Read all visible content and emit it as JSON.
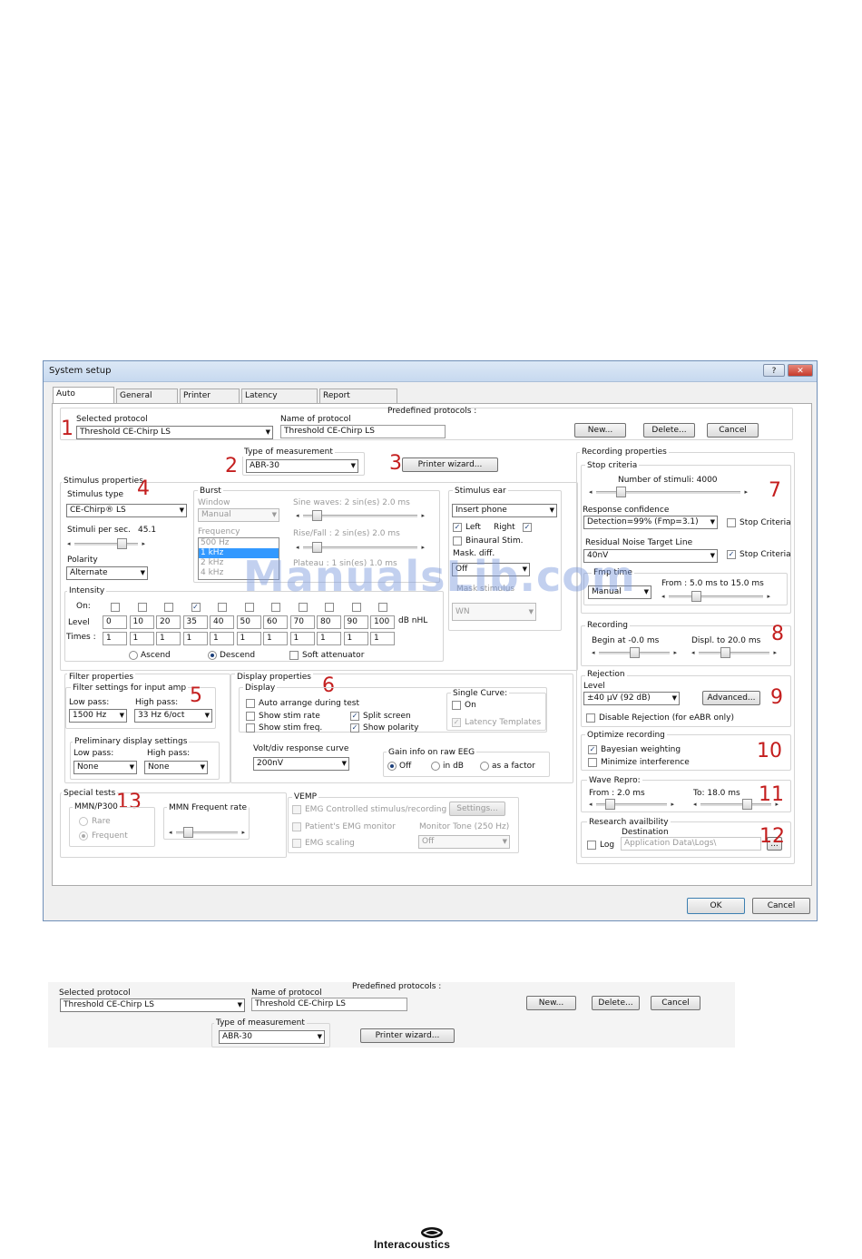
{
  "window": {
    "title": "System setup",
    "help": "?",
    "close": "✕"
  },
  "tabs": [
    "Auto protocols",
    "General Setup",
    "Printer Setup",
    "Latency Template",
    "Report Templates"
  ],
  "markers": [
    "1",
    "2",
    "3",
    "4",
    "5",
    "6",
    "7",
    "8",
    "9",
    "10",
    "11",
    "12",
    "13"
  ],
  "protocol": {
    "selected_label": "Selected protocol",
    "selected_value": "Threshold CE-Chirp LS",
    "name_label": "Name of protocol",
    "name_value": "Threshold CE-Chirp LS",
    "predefined_label": "Predefined protocols :",
    "new": "New...",
    "delete": "Delete...",
    "cancel": "Cancel"
  },
  "measurement": {
    "label": "Type of measurement",
    "value": "ABR-30",
    "printer_wizard": "Printer wizard..."
  },
  "stimulus": {
    "group": "Stimulus properties",
    "type_label": "Stimulus type",
    "type_value": "CE-Chirp® LS",
    "rate_label": "Stimuli per sec.",
    "rate_value": "45.1",
    "polarity_label": "Polarity",
    "polarity_value": "Alternate",
    "burst": "Burst",
    "window_label": "Window",
    "window_value": "Manual",
    "sine_label": "Sine waves: 2 sin(es) 2.0 ms",
    "freq_label": "Frequency",
    "freqs": [
      "500 Hz",
      "1 kHz",
      "2 kHz",
      "4 kHz"
    ],
    "rise_label": "Rise/Fall : 2 sin(es) 2.0 ms",
    "plateau_label": "Plateau : 1 sin(es) 1.0 ms",
    "ear_group": "Stimulus ear",
    "ear_value": "Insert phone",
    "left": "Left",
    "right": "Right",
    "binaural": "Binaural Stim.",
    "mask_label": "Mask. diff.",
    "mask_value": "Off",
    "mask_stim_label": "Mask stimulus",
    "mask_stim_value": "WN"
  },
  "intensity": {
    "group": "Intensity",
    "on_label": "On:",
    "level_label": "Level",
    "times_label": "Times :",
    "levels": [
      "0",
      "10",
      "20",
      "35",
      "40",
      "50",
      "60",
      "70",
      "80",
      "90",
      "100"
    ],
    "checked": [
      false,
      false,
      false,
      true,
      false,
      false,
      false,
      false,
      false,
      false,
      false
    ],
    "times": [
      "1",
      "1",
      "1",
      "1",
      "1",
      "1",
      "1",
      "1",
      "1",
      "1",
      "1"
    ],
    "unit": "dB nHL",
    "ascend": "Ascend",
    "descend": "Descend",
    "soft": "Soft attenuator"
  },
  "filter": {
    "group": "Filter properties",
    "input_label": "Filter settings for input amp",
    "low_label": "Low pass:",
    "low_value": "1500 Hz",
    "high_label": "High pass:",
    "high_value": "33 Hz 6/oct",
    "prelim_label": "Preliminary display settings",
    "plow_label": "Low pass:",
    "plow_value": "None",
    "phigh_label": "High pass:",
    "phigh_value": "None"
  },
  "display": {
    "group": "Display properties",
    "sub": "Display",
    "auto": "Auto arrange during test",
    "stim_rate": "Show stim rate",
    "stim_freq": "Show stim freq.",
    "split": "Split screen",
    "polarity": "Show polarity",
    "single_label": "Single Curve:",
    "single_on": "On",
    "latency": "Latency Templates",
    "volt_label": "Volt/div response curve",
    "volt_value": "200nV",
    "gain_label": "Gain info on raw EEG",
    "gain_off": "Off",
    "gain_db": "in dB",
    "gain_factor": "as a factor"
  },
  "special": {
    "group": "Special tests",
    "mmn": "MMN/P300",
    "rare": "Rare",
    "frequent": "Frequent",
    "mmn_rate": "MMN Frequent rate"
  },
  "vemp": {
    "group": "VEMP",
    "emg": "EMG Controlled stimulus/recording",
    "settings": "Settings...",
    "monitor": "Patient's EMG monitor",
    "tone_label": "Monitor Tone (250 Hz)",
    "tone_value": "Off",
    "scaling": "EMG scaling"
  },
  "recording_props": {
    "group": "Recording properties",
    "stop": "Stop criteria",
    "stimuli": "Number of stimuli: 4000",
    "conf_label": "Response confidence",
    "conf_value": "Detection=99% (Fmp=3.1)",
    "stop_crit": "Stop Criteria",
    "rn_label": "Residual Noise Target Line",
    "rn_value": "40nV",
    "fmp_label": "Fmp time",
    "fmp_value": "Manual",
    "fmp_range": "From : 5.0 ms to 15.0 ms"
  },
  "recording": {
    "group": "Recording",
    "begin": "Begin at  -0.0 ms",
    "displ": "Displ. to  20.0 ms"
  },
  "rejection": {
    "group": "Rejection",
    "level_label": "Level",
    "level_value": "±40 µV (92 dB)",
    "advanced": "Advanced...",
    "disable": "Disable Rejection (for eABR only)"
  },
  "optimize": {
    "group": "Optimize recording",
    "bayes": "Bayesian weighting",
    "minimize": "Minimize interference"
  },
  "wave": {
    "group": "Wave Repro:",
    "from": "From : 2.0 ms",
    "to": "To:  18.0 ms"
  },
  "research": {
    "group": "Research availbility",
    "dest": "Destination",
    "log": "Log",
    "path": "Application Data\\Logs\\",
    "browse": "..."
  },
  "footer": {
    "ok": "OK",
    "cancel": "Cancel"
  },
  "watermark": "ManualsLib.com",
  "crop": {
    "selected_label": "Selected protocol",
    "selected_value": "Threshold CE-Chirp LS",
    "name_label": "Name of protocol",
    "name_value": "Threshold CE-Chirp LS",
    "predefined": "Predefined protocols :",
    "new": "New...",
    "delete": "Delete...",
    "cancel": "Cancel",
    "type_label": "Type of measurement",
    "type_value": "ABR-30",
    "printer": "Printer wizard..."
  },
  "brand": {
    "name": "Interacoustics"
  }
}
